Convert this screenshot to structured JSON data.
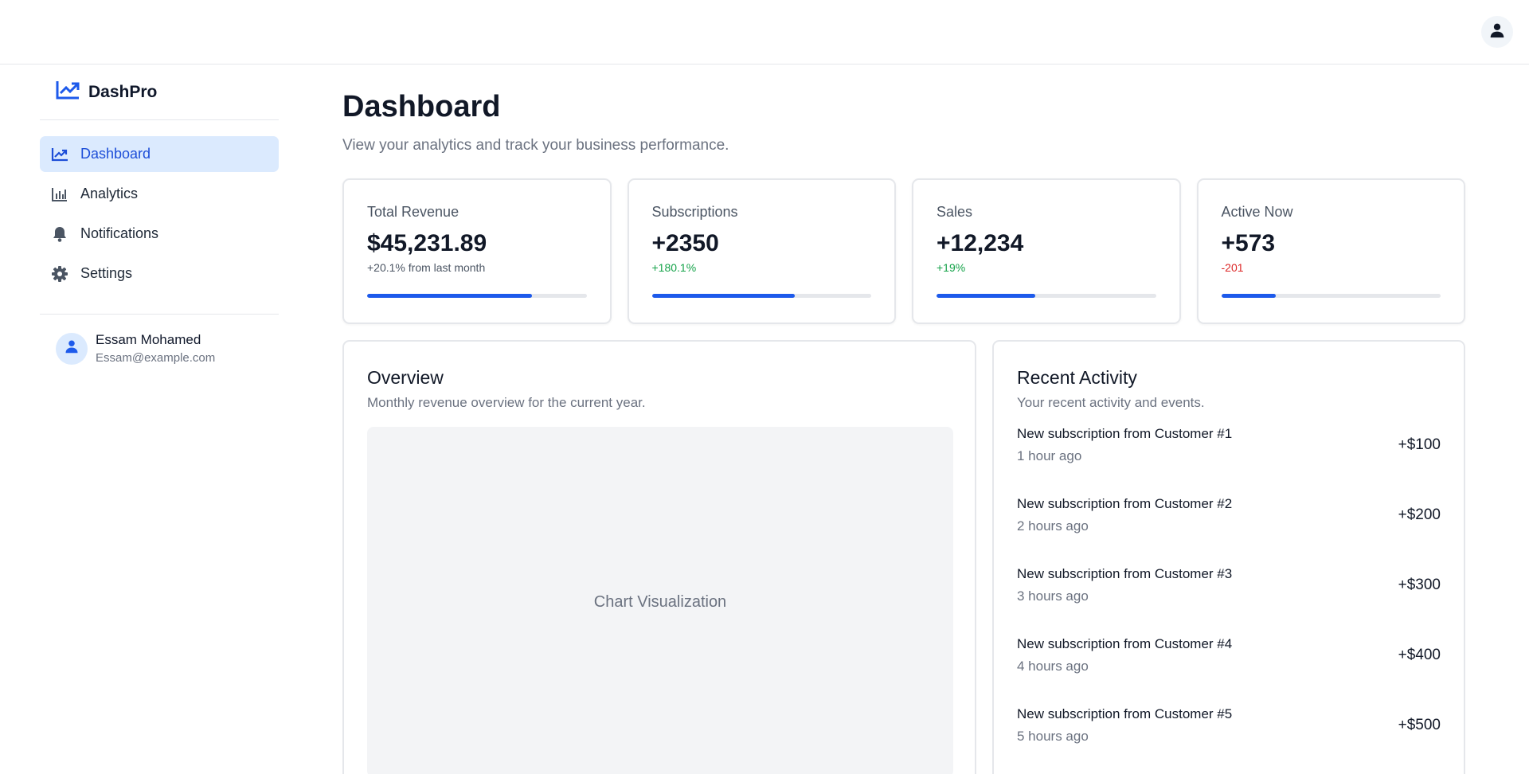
{
  "brand": {
    "name": "DashPro"
  },
  "colors": {
    "accent": "#1d5aeb",
    "active_bg": "#dbeafe",
    "positive": "#16a34a",
    "negative": "#dc2626"
  },
  "sidebar": {
    "items": [
      {
        "label": "Dashboard",
        "icon": "trending-up-icon",
        "active": true
      },
      {
        "label": "Analytics",
        "icon": "bar-chart-icon",
        "active": false
      },
      {
        "label": "Notifications",
        "icon": "bell-icon",
        "active": false
      },
      {
        "label": "Settings",
        "icon": "gear-icon",
        "active": false
      }
    ],
    "user": {
      "name": "Essam Mohamed",
      "email": "Essam@example.com"
    }
  },
  "header": {
    "title": "Dashboard",
    "subtitle": "View your analytics and track your business performance."
  },
  "stats": [
    {
      "label": "Total Revenue",
      "value": "$45,231.89",
      "change": "+20.1% from last month",
      "progress": 0.75
    },
    {
      "label": "Subscriptions",
      "value": "+2350",
      "change": "+180.1%",
      "progress": 0.65
    },
    {
      "label": "Sales",
      "value": "+12,234",
      "change": "+19%",
      "progress": 0.45
    },
    {
      "label": "Active Now",
      "value": "+573",
      "change": "-201",
      "progress": 0.25
    }
  ],
  "overview": {
    "title": "Overview",
    "subtitle": "Monthly revenue overview for the current year.",
    "placeholder": "Chart Visualization"
  },
  "activity": {
    "title": "Recent Activity",
    "subtitle": "Your recent activity and events.",
    "items": [
      {
        "title": "New subscription from Customer #1",
        "time": "1 hour ago",
        "amount": "+$100"
      },
      {
        "title": "New subscription from Customer #2",
        "time": "2 hours ago",
        "amount": "+$200"
      },
      {
        "title": "New subscription from Customer #3",
        "time": "3 hours ago",
        "amount": "+$300"
      },
      {
        "title": "New subscription from Customer #4",
        "time": "4 hours ago",
        "amount": "+$400"
      },
      {
        "title": "New subscription from Customer #5",
        "time": "5 hours ago",
        "amount": "+$500"
      }
    ]
  }
}
